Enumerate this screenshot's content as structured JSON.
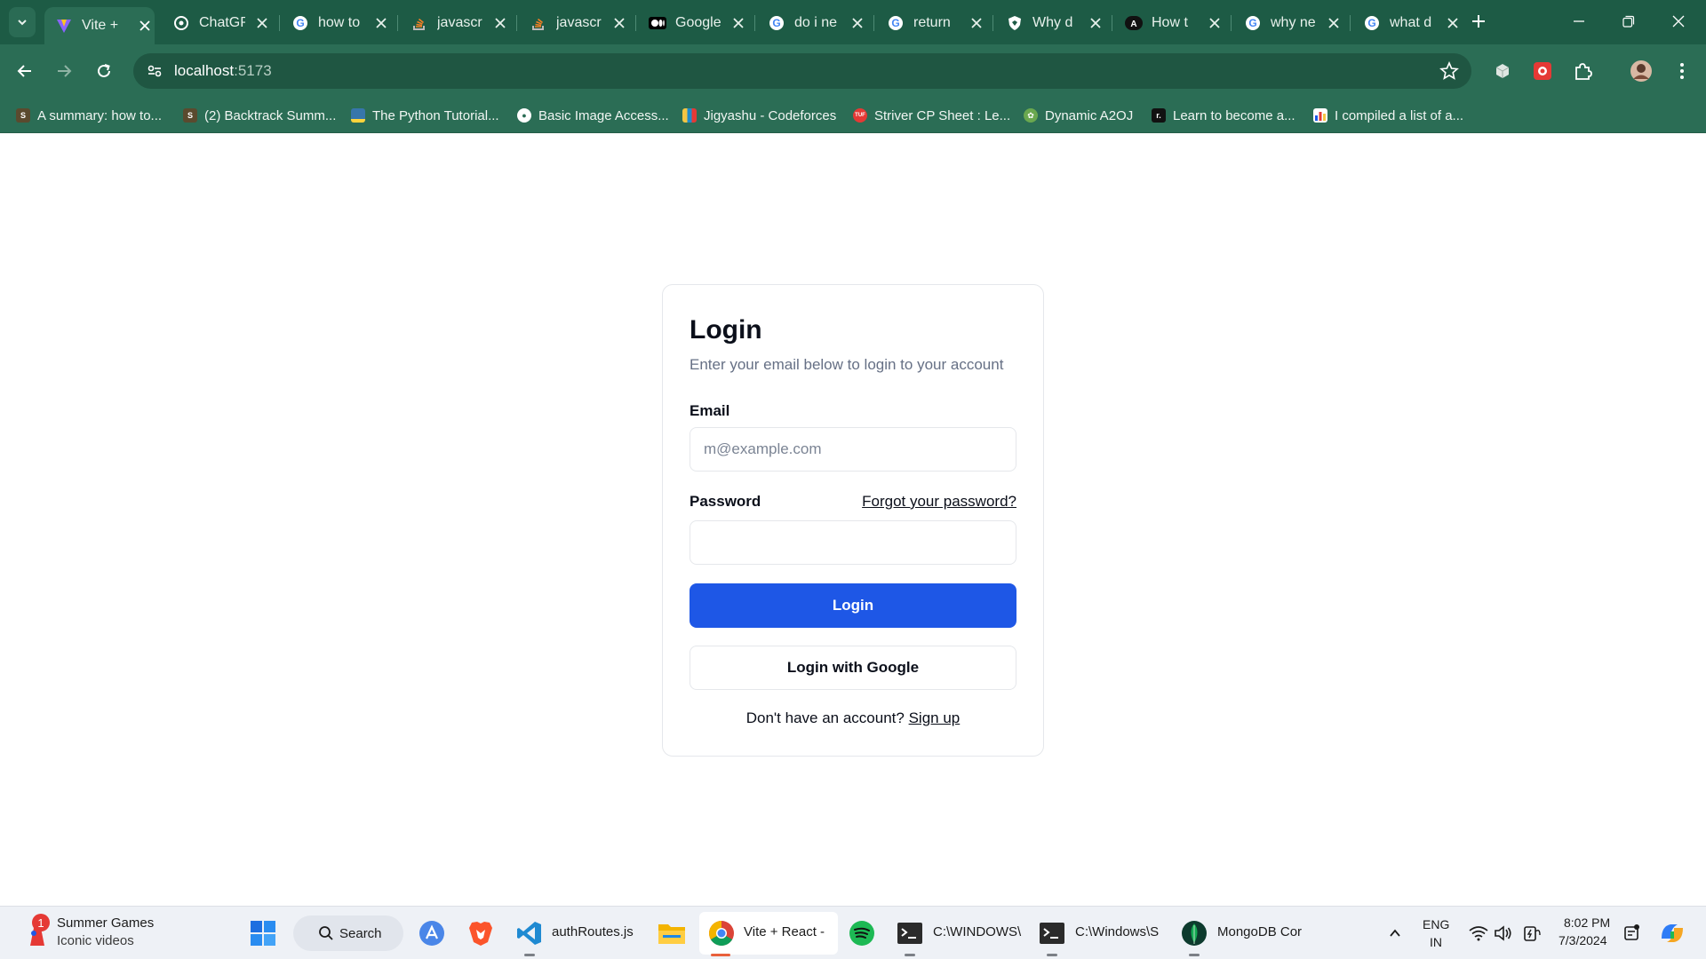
{
  "browser": {
    "tabs": [
      {
        "title": "Vite +",
        "icon": "vite-icon",
        "active": true
      },
      {
        "title": "ChatGPT",
        "icon": "chatgpt-icon"
      },
      {
        "title": "how to",
        "icon": "google-icon"
      },
      {
        "title": "javascr",
        "icon": "stackoverflow-icon"
      },
      {
        "title": "javascr",
        "icon": "stackoverflow-icon"
      },
      {
        "title": "Google",
        "icon": "medium-icon"
      },
      {
        "title": "do i ne",
        "icon": "google-icon"
      },
      {
        "title": "return",
        "icon": "google-icon"
      },
      {
        "title": "Why d",
        "icon": "shield-icon"
      },
      {
        "title": "How t",
        "icon": "angular-icon"
      },
      {
        "title": "why ne",
        "icon": "google-icon"
      },
      {
        "title": "what d",
        "icon": "google-icon"
      }
    ],
    "url_host": "localhost",
    "url_port": ":5173",
    "bookmarks": [
      {
        "label": "A summary: how to...",
        "icon": "stackoverflow-icon",
        "color": "#f48024"
      },
      {
        "label": "(2) Backtrack Summ...",
        "icon": "stackoverflow-icon",
        "color": "#f48024"
      },
      {
        "label": "The Python Tutorial...",
        "icon": "python-icon",
        "color": "#3776ab"
      },
      {
        "label": "Basic Image Access...",
        "icon": "globe-icon",
        "color": "#ffffff"
      },
      {
        "label": "Jigyashu - Codeforces",
        "icon": "codeforces-icon",
        "color": "#1f8acb"
      },
      {
        "label": "Striver CP Sheet : Le...",
        "icon": "tuf-icon",
        "color": "#e53935"
      },
      {
        "label": "Dynamic A2OJ",
        "icon": "a2oj-icon",
        "color": "#6aa84f"
      },
      {
        "label": "Learn to become a...",
        "icon": "roadmap-icon",
        "color": "#111111"
      },
      {
        "label": "I compiled a list of a...",
        "icon": "chart-icon",
        "color": "#ffffff"
      }
    ]
  },
  "login": {
    "title": "Login",
    "subtitle": "Enter your email below to login to your account",
    "email_label": "Email",
    "email_placeholder": "m@example.com",
    "password_label": "Password",
    "forgot_label": "Forgot your password?",
    "login_button": "Login",
    "google_button": "Login with Google",
    "no_account_text": "Don't have an account?",
    "signup_link": "Sign up"
  },
  "taskbar": {
    "widget_title": "Summer Games",
    "widget_subtitle": "Iconic videos",
    "widget_badge": "1",
    "search_label": "Search",
    "apps": [
      {
        "label": "authRoutes.js",
        "icon": "vscode-icon"
      },
      {
        "label": "Vite + React -",
        "icon": "chrome-icon"
      },
      {
        "label": "C:\\WINDOWS\\",
        "icon": "terminal-icon"
      },
      {
        "label": "C:\\Windows\\S",
        "icon": "terminal-icon"
      },
      {
        "label": "MongoDB Cor",
        "icon": "mongodb-icon"
      }
    ],
    "lang_top": "ENG",
    "lang_bottom": "IN",
    "time": "8:02 PM",
    "date": "7/3/2024"
  },
  "colors": {
    "chrome_frame": "#1d5b45",
    "chrome_toolbar": "#2b6d55",
    "primary_button": "#1e57e6"
  }
}
